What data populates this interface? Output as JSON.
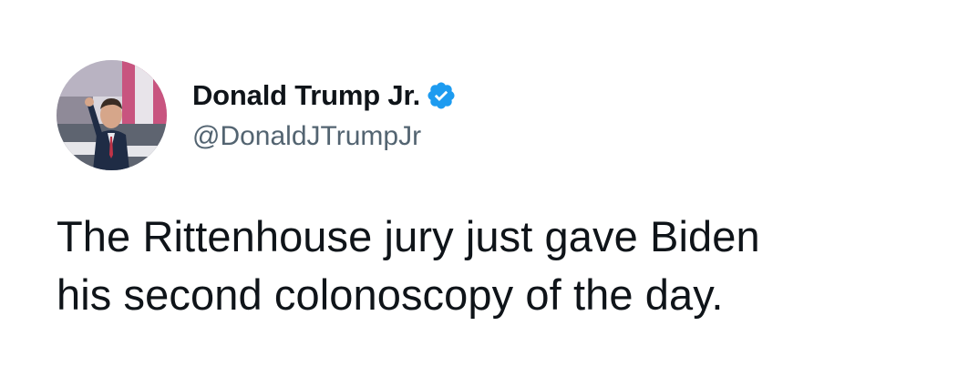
{
  "author": {
    "display_name": "Donald Trump Jr.",
    "handle": "@DonaldJTrumpJr",
    "verified": true,
    "verified_color": "#1d9bf0",
    "avatar_icon": "profile-photo"
  },
  "tweet": {
    "text": "The Rittenhouse jury just gave Biden\nhis second colonoscopy of the day."
  },
  "colors": {
    "text": "#0f1419",
    "handle": "#536471",
    "background": "#ffffff"
  }
}
